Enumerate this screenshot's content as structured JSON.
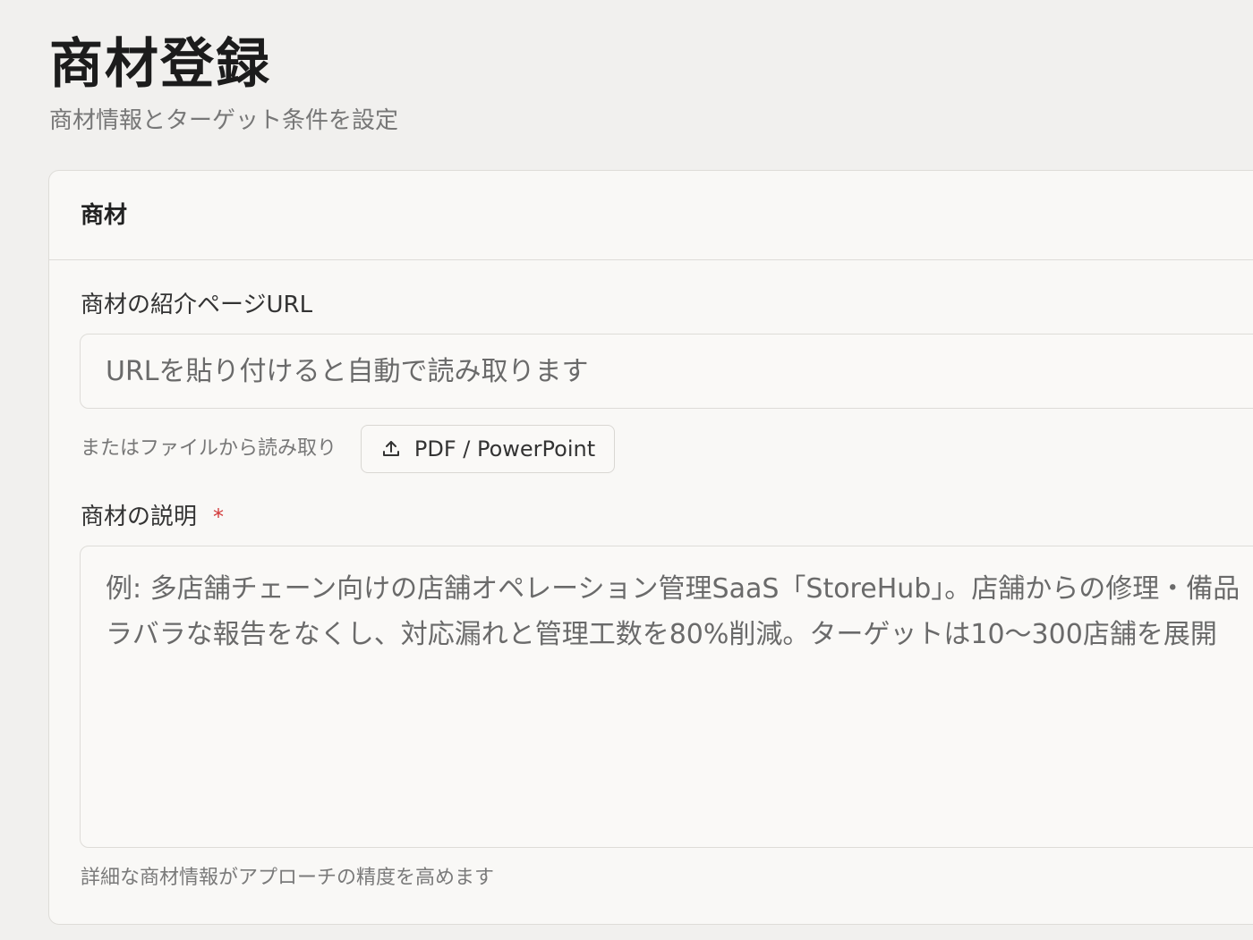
{
  "page": {
    "title": "商材登録",
    "subtitle": "商材情報とターゲット条件を設定"
  },
  "card": {
    "title": "商材"
  },
  "url_field": {
    "label": "商材の紹介ページURL",
    "placeholder": "URLを貼り付けると自動で読み取ります",
    "value": ""
  },
  "file_import": {
    "hint": "またはファイルから読み取り",
    "button_label": "PDF / PowerPoint",
    "button_icon": "upload-icon"
  },
  "description_field": {
    "label": "商材の説明",
    "required_mark": "*",
    "placeholder": "例: 多店舗チェーン向けの店舗オペレーション管理SaaS「StoreHub」。店舗からの修理・備品\nラバラな報告をなくし、対応漏れと管理工数を80%削減。ターゲットは10〜300店舗を展開",
    "value": "",
    "help_text": "詳細な商材情報がアプローチの精度を高めます"
  },
  "colors": {
    "background": "#f1f0ee",
    "card": "#f9f8f6",
    "border": "#dedcd8",
    "required": "#d23a3a"
  }
}
